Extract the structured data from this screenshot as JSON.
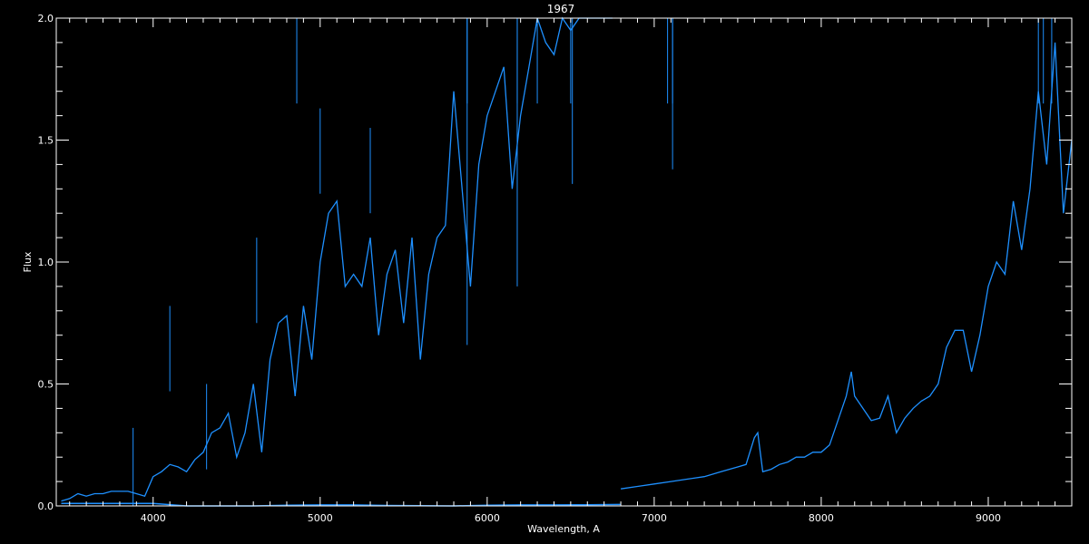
{
  "chart_data": {
    "type": "line",
    "title": "1967",
    "xlabel": "Wavelength, A",
    "ylabel": "Flux",
    "xlim": [
      3420,
      9500
    ],
    "ylim": [
      0.0,
      2.0
    ],
    "x_major_ticks": [
      4000,
      5000,
      6000,
      7000,
      8000,
      9000
    ],
    "x_tick_labels": [
      "4000",
      "5000",
      "6000",
      "7000",
      "8000",
      "9000"
    ],
    "x_minor_step": 100,
    "y_major_ticks": [
      0.0,
      0.5,
      1.0,
      1.5,
      2.0
    ],
    "y_tick_labels": [
      "0.0",
      "0.5",
      "1.0",
      "1.5",
      "2.0"
    ],
    "y_minor_step": 0.1,
    "grid": false,
    "colors": {
      "background": "#000000",
      "axes": "#ffffff",
      "series": "#1e90ff"
    },
    "series": [
      {
        "x": [
          3450,
          3500,
          3550,
          3600,
          3650,
          3700,
          3750,
          3800,
          3850,
          3900,
          3950,
          4000,
          4050,
          4100,
          4150,
          4200,
          4250,
          4300,
          4350,
          4400,
          4450,
          4500,
          4550,
          4600,
          4650,
          4700,
          4750,
          4800,
          4850,
          4900,
          4950,
          5000,
          5050,
          5100,
          5150,
          5200,
          5250,
          5300,
          5350,
          5400,
          5450,
          5500,
          5550,
          5600,
          5650,
          5700,
          5750,
          5800,
          5850,
          5900,
          5950,
          6000,
          6050,
          6100,
          6150,
          6200,
          6250,
          6300,
          6350,
          6400,
          6450,
          6500,
          6550,
          6600,
          6650,
          6700,
          6750
        ],
        "y": [
          0.02,
          0.03,
          0.05,
          0.04,
          0.05,
          0.05,
          0.06,
          0.06,
          0.06,
          0.05,
          0.04,
          0.12,
          0.14,
          0.17,
          0.16,
          0.14,
          0.19,
          0.22,
          0.3,
          0.32,
          0.38,
          0.2,
          0.3,
          0.5,
          0.22,
          0.6,
          0.75,
          0.78,
          0.45,
          0.82,
          0.6,
          1.0,
          1.2,
          1.25,
          0.9,
          0.95,
          0.9,
          1.1,
          0.7,
          0.95,
          1.05,
          0.75,
          1.1,
          0.6,
          0.95,
          1.1,
          1.15,
          1.7,
          1.3,
          0.9,
          1.4,
          1.6,
          1.7,
          1.8,
          1.3,
          1.6,
          1.8,
          2.0,
          1.9,
          1.85,
          2.0,
          1.95,
          2.0,
          2.0,
          2.0,
          2.0,
          2.0
        ]
      },
      {
        "x": [
          3450,
          3600,
          3800,
          4000,
          4200,
          4400,
          4600,
          4800,
          5000,
          5200,
          5400,
          5600,
          5800,
          6000,
          6200,
          6400,
          6600,
          6800
        ],
        "y": [
          0.01,
          0.01,
          0.01,
          0.01,
          0.0,
          0.0,
          0.0,
          0.003,
          0.004,
          0.004,
          0.002,
          0.001,
          0.0,
          0.003,
          0.004,
          0.004,
          0.005,
          0.006
        ]
      },
      {
        "x": [
          6800,
          6900,
          7000,
          7100,
          7200,
          7300,
          7400,
          7500,
          7550,
          7600,
          7620,
          7650,
          7700,
          7750,
          7800,
          7850,
          7900,
          7950,
          8000,
          8050,
          8100,
          8150,
          8180,
          8200,
          8250,
          8300,
          8350,
          8400,
          8450,
          8500,
          8550,
          8600,
          8650,
          8700,
          8750,
          8800,
          8850,
          8900,
          8950,
          9000,
          9050,
          9100,
          9150,
          9200,
          9250,
          9300,
          9350,
          9400,
          9450,
          9500
        ],
        "y": [
          0.07,
          0.08,
          0.09,
          0.1,
          0.11,
          0.12,
          0.14,
          0.16,
          0.17,
          0.28,
          0.3,
          0.14,
          0.15,
          0.17,
          0.18,
          0.2,
          0.2,
          0.22,
          0.22,
          0.25,
          0.35,
          0.45,
          0.55,
          0.45,
          0.4,
          0.35,
          0.36,
          0.45,
          0.3,
          0.36,
          0.4,
          0.43,
          0.45,
          0.5,
          0.65,
          0.72,
          0.72,
          0.55,
          0.7,
          0.9,
          1.0,
          0.95,
          1.25,
          1.05,
          1.3,
          1.7,
          1.4,
          1.9,
          1.2,
          1.5
        ]
      }
    ],
    "spikes": [
      {
        "x": 4100,
        "y": 0.82
      },
      {
        "x": 3880,
        "y": 0.32
      },
      {
        "x": 4320,
        "y": 0.5
      },
      {
        "x": 4620,
        "y": 1.1
      },
      {
        "x": 4860,
        "y": 2.0
      },
      {
        "x": 5000,
        "y": 1.63
      },
      {
        "x": 5300,
        "y": 1.55
      },
      {
        "x": 5880,
        "y": 2.0
      },
      {
        "x": 6180,
        "y": 2.0
      },
      {
        "x": 6300,
        "y": 2.0
      },
      {
        "x": 6500,
        "y": 2.0
      },
      {
        "x": 7080,
        "y": 2.0
      },
      {
        "x": 7110,
        "y": 2.0
      },
      {
        "x": 9300,
        "y": 2.0
      },
      {
        "x": 9330,
        "y": 2.0
      },
      {
        "x": 9380,
        "y": 2.0
      }
    ],
    "dips": [
      {
        "x": 5880,
        "y": 0.66
      },
      {
        "x": 6180,
        "y": 0.9
      },
      {
        "x": 7110,
        "y": 1.38
      },
      {
        "x": 6510,
        "y": 1.32
      }
    ]
  }
}
